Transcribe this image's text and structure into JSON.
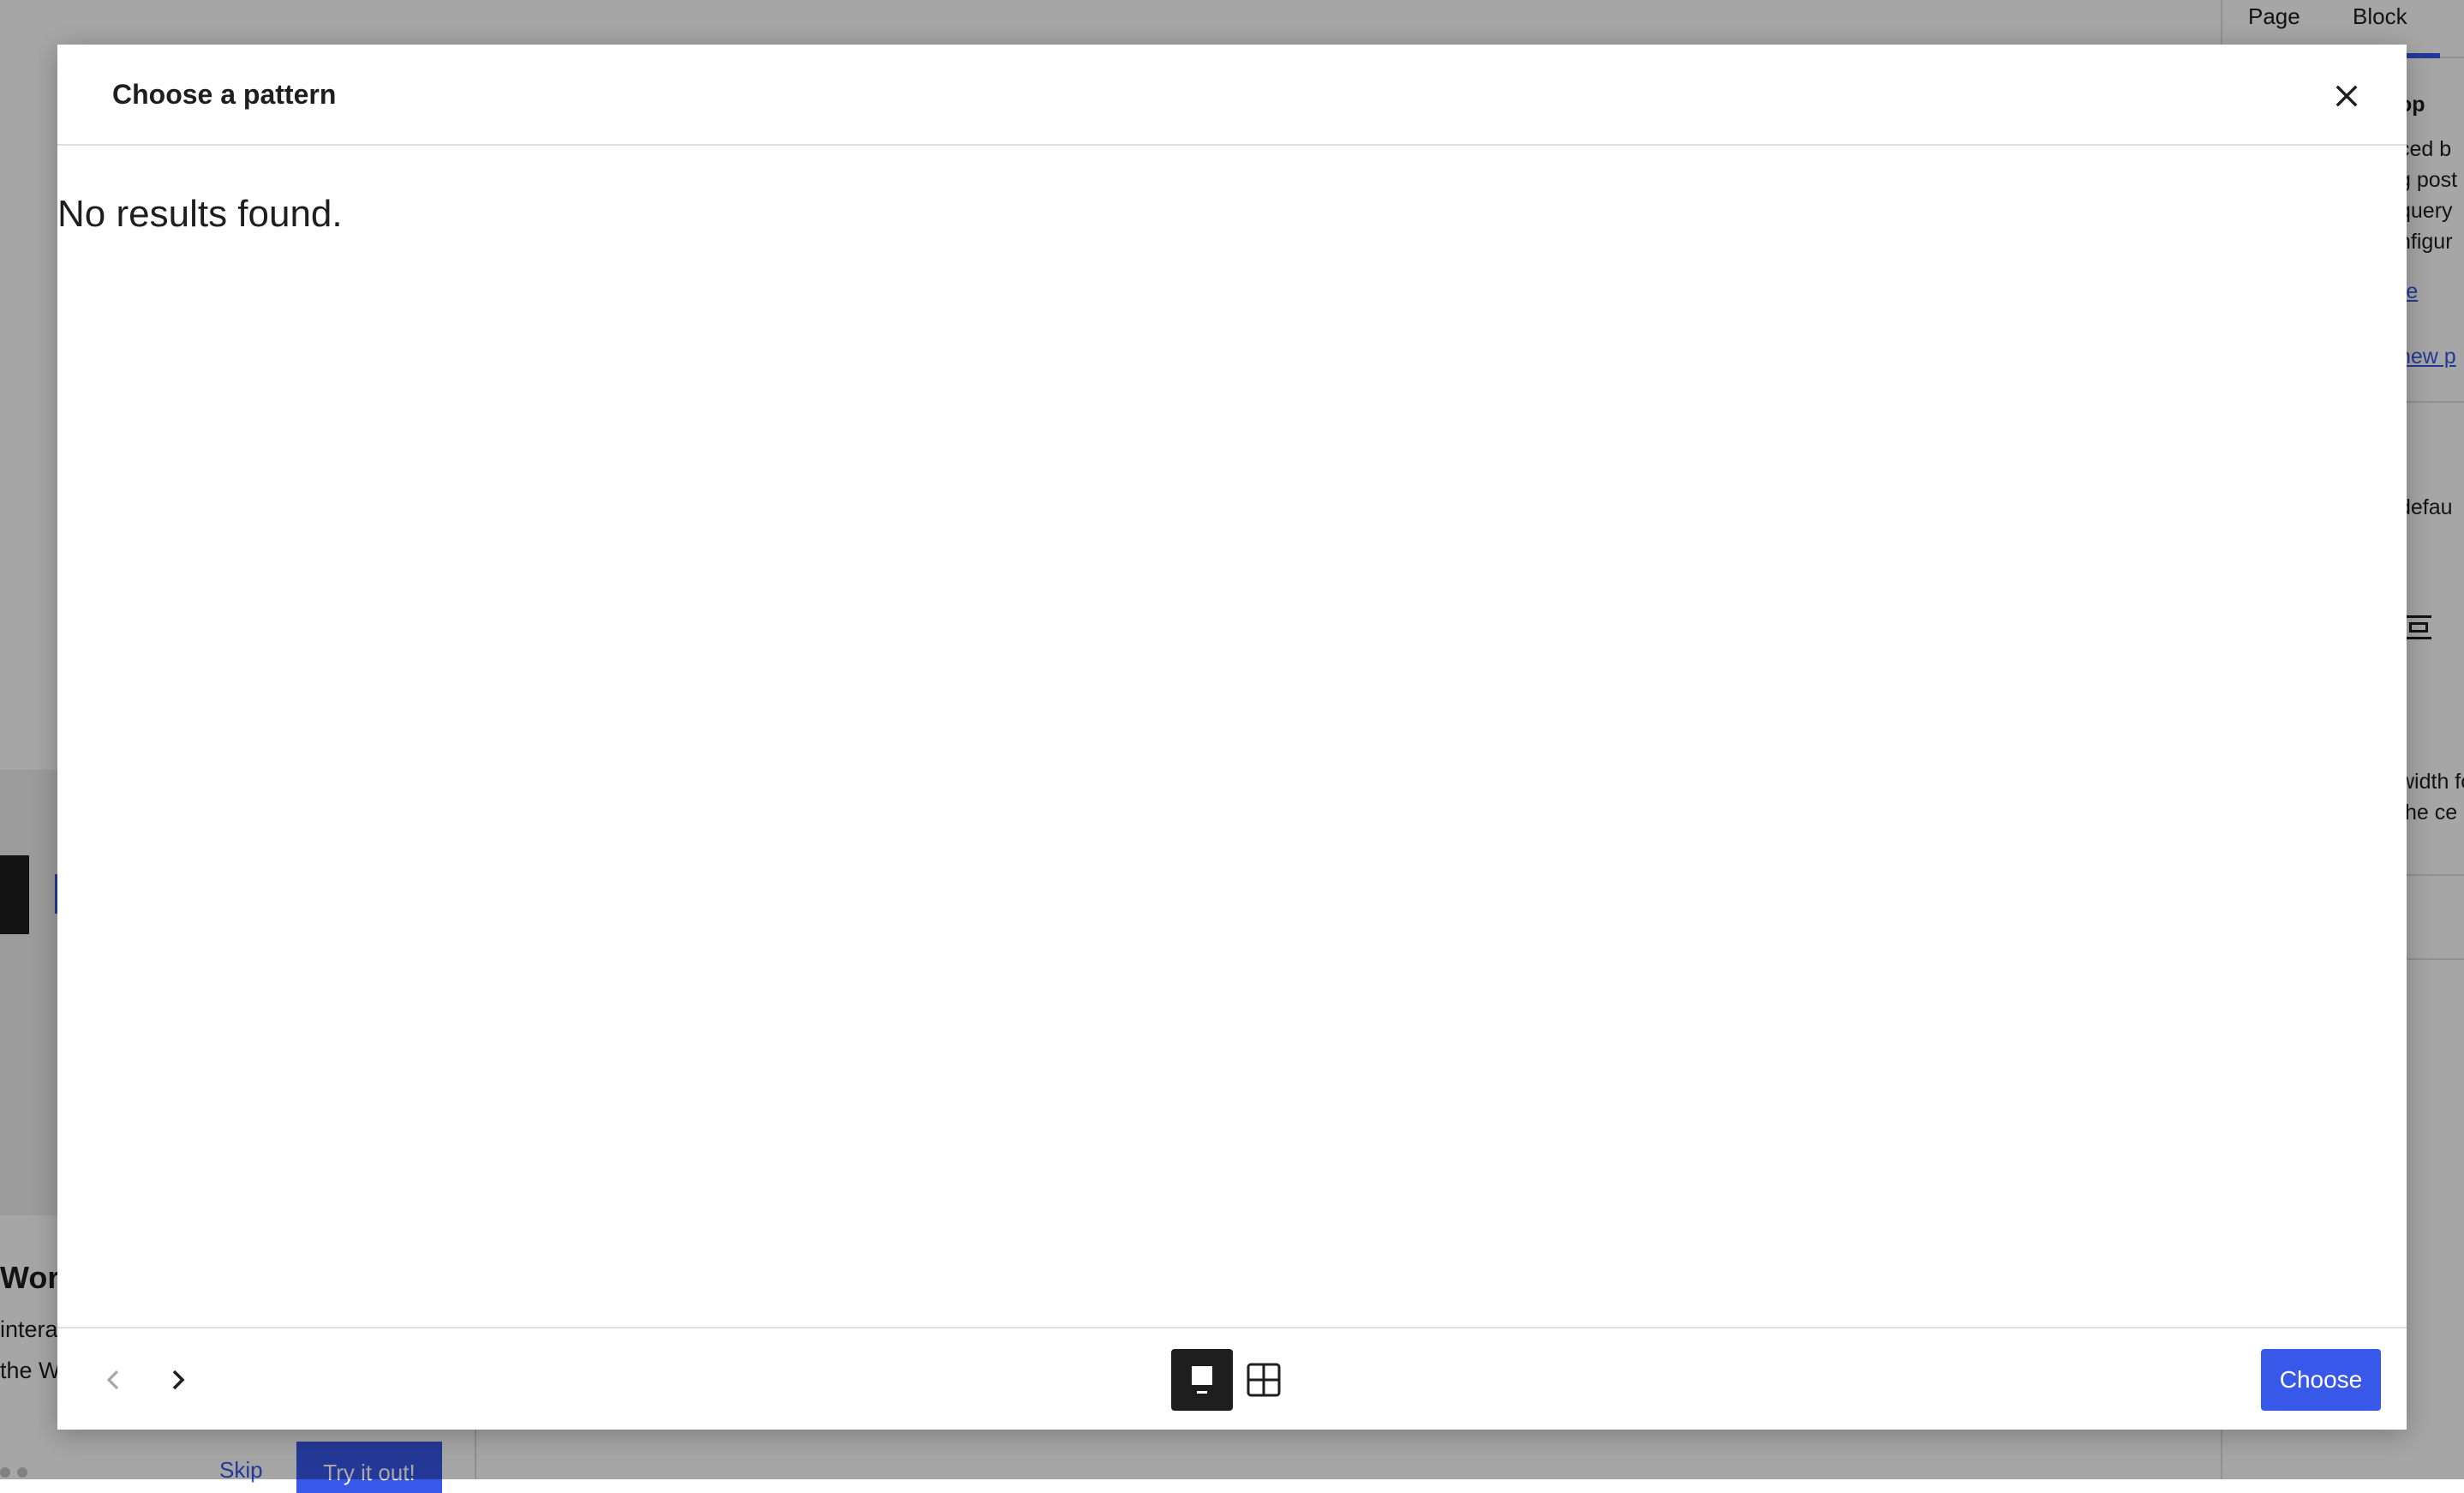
{
  "editor": {
    "sidebar": {
      "tabs": [
        {
          "label": "Page"
        },
        {
          "label": "Block"
        }
      ],
      "fragments": {
        "heading": "op",
        "line1": "ced b",
        "line2": "g post",
        "line3": "query",
        "line4": "nfigur",
        "learn_more": "re",
        "new_link": "new p",
        "default": "defau",
        "width1": "width fo",
        "width2": "the ce"
      }
    },
    "welcome_guide": {
      "title": "Word",
      "line1": "intera",
      "line2": "the W",
      "skip_label": "Skip",
      "try_label": "Try it out!"
    }
  },
  "modal": {
    "title": "Choose a pattern",
    "close_label": "Close",
    "empty_message": "No results found.",
    "footer": {
      "prev_label": "Previous pattern",
      "next_label": "Next pattern",
      "carousel_view_label": "Carousel view",
      "grid_view_label": "Grid view",
      "active_view": "carousel",
      "choose_label": "Choose"
    }
  },
  "colors": {
    "accent": "#3858e9",
    "text": "#1e1e1e",
    "divider": "#e0e0e0"
  },
  "icons": {
    "close": "close-icon",
    "prev": "chevron-left-icon",
    "next": "chevron-right-icon",
    "carousel": "carousel-view-icon",
    "grid": "grid-view-icon"
  }
}
